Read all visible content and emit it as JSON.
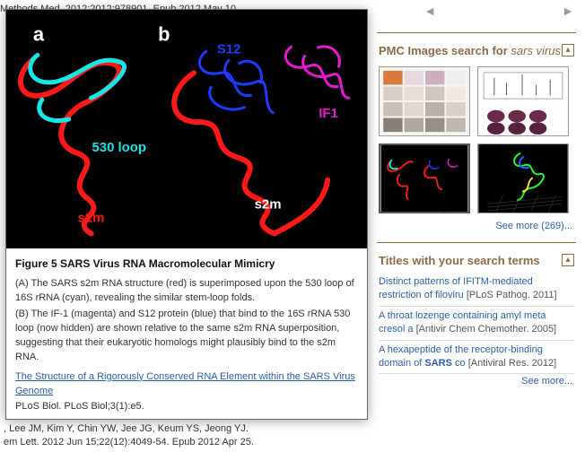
{
  "nav": {
    "left": "◄",
    "right": "►"
  },
  "background": {
    "top_frag": "Methods Med. 2012;2012:978901. Epub 2012 May 10.",
    "authors_frag": ", Lee JM, Kim Y, Chin YW, Jee JG, Keum YS, Jeong YJ.",
    "bottom_frag": "em Lett. 2012 Jun 15;22(12):4049-54. Epub 2012 Apr 25."
  },
  "popup": {
    "figure_label": "Figure 5    SARS Virus RNA Macromolecular Mimicry",
    "desc_a": "(A) The SARS s2m RNA structure (red) is superimposed upon the 530 loop of 16S rRNA (cyan), revealing the similar stem-loop folds.",
    "desc_b": "(B) The IF-1 (magenta) and S12 protein (blue) that bind to the 16S rRNA 530 loop (now hidden) are shown relative to the same s2m RNA superposition, suggesting that their eukaryotic homologs might plausibly bind to the s2m RNA.",
    "article_link": "The Structure of a Rigorously Conserved RNA Element within the SARS Virus Genome",
    "source": "PLoS Biol. PLoS Biol;3(1):e5.",
    "labels": {
      "a": "a",
      "b": "b",
      "s12": "S12",
      "if1": "IF1",
      "loop530": "530 loop",
      "s2m_left": "s2m",
      "s2m_right": "s2m"
    }
  },
  "right": {
    "images_search_header": "PMC Images search for ",
    "images_search_query": "sars virus",
    "see_more_images": "See more (269)...",
    "titles_header": "Titles with your search terms",
    "titles": [
      {
        "link": "Distinct patterns of IFITM-mediated restriction of filoviru",
        "journal": "[PLoS Pathog. 2011]"
      },
      {
        "link": "A throat lozenge containing amyl meta cresol a",
        "journal": "[Antivir Chem Chemother. 2005]"
      },
      {
        "link": "A hexapeptide of the receptor-binding domain of ",
        "bold": "SARS",
        "link2": " co",
        "journal": "[Antiviral Res. 2012]"
      }
    ],
    "see_more_titles": "See more..."
  }
}
